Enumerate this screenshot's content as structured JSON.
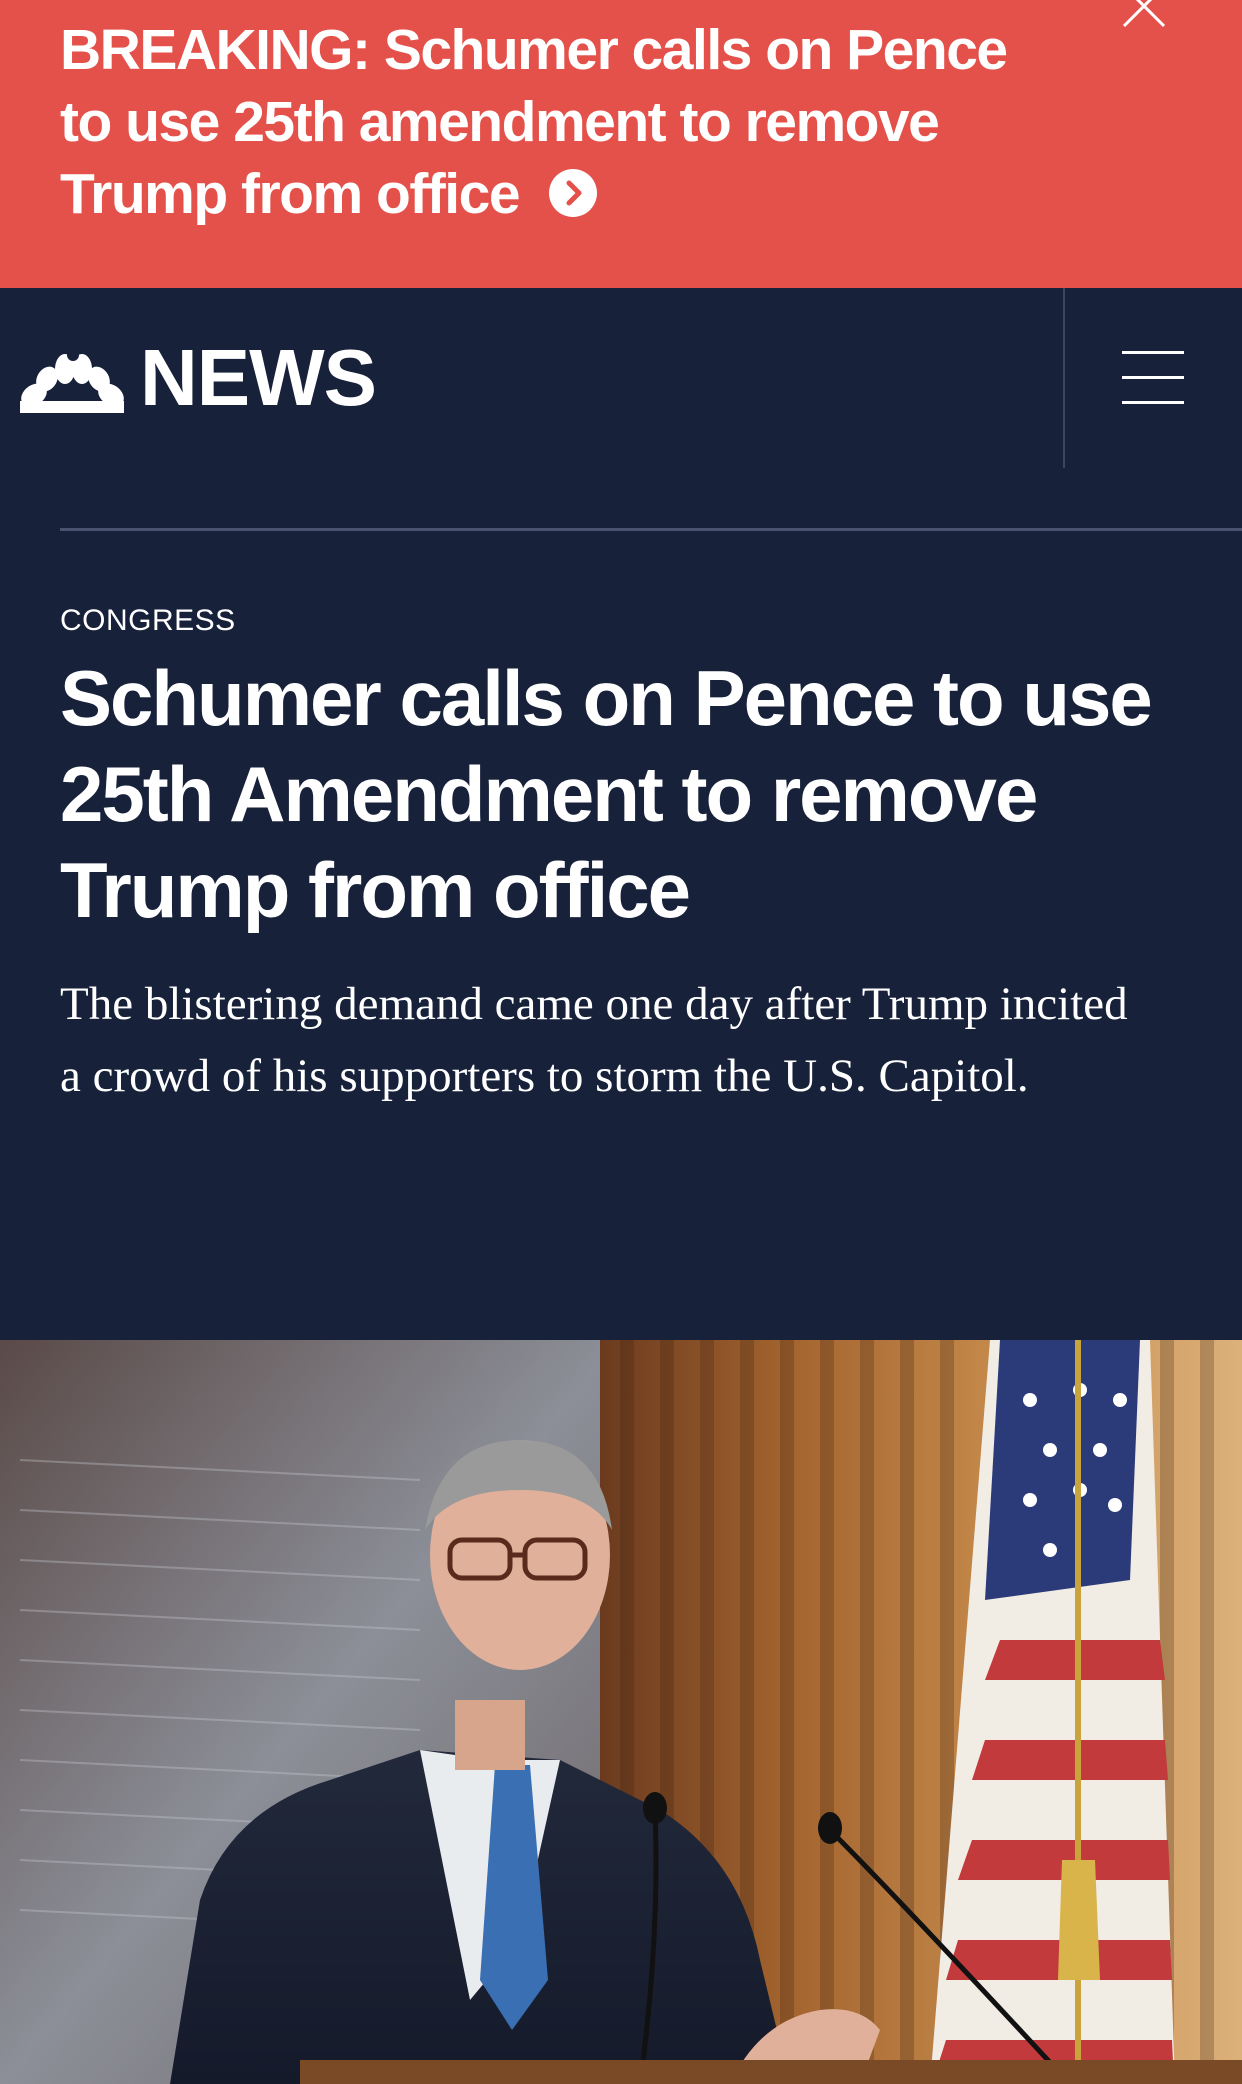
{
  "breaking": {
    "text": "BREAKING: Schumer calls on Pence to use 25th amendment to remove Trump from office",
    "arrow_icon": "chevron-right-circle-icon",
    "close_icon": "close-icon"
  },
  "header": {
    "logo_icon": "nbc-peacock-icon",
    "logo_text": "NEWS",
    "menu_icon": "hamburger-menu-icon"
  },
  "article": {
    "category": "CONGRESS",
    "headline": "Schumer calls on Pence to use 25th Amendment to remove Trump from office",
    "dek": "The blistering demand came one day after Trump incited a crowd of his supporters to storm the U.S. Capitol."
  },
  "colors": {
    "banner": "#e4514a",
    "navy": "#17213a"
  }
}
